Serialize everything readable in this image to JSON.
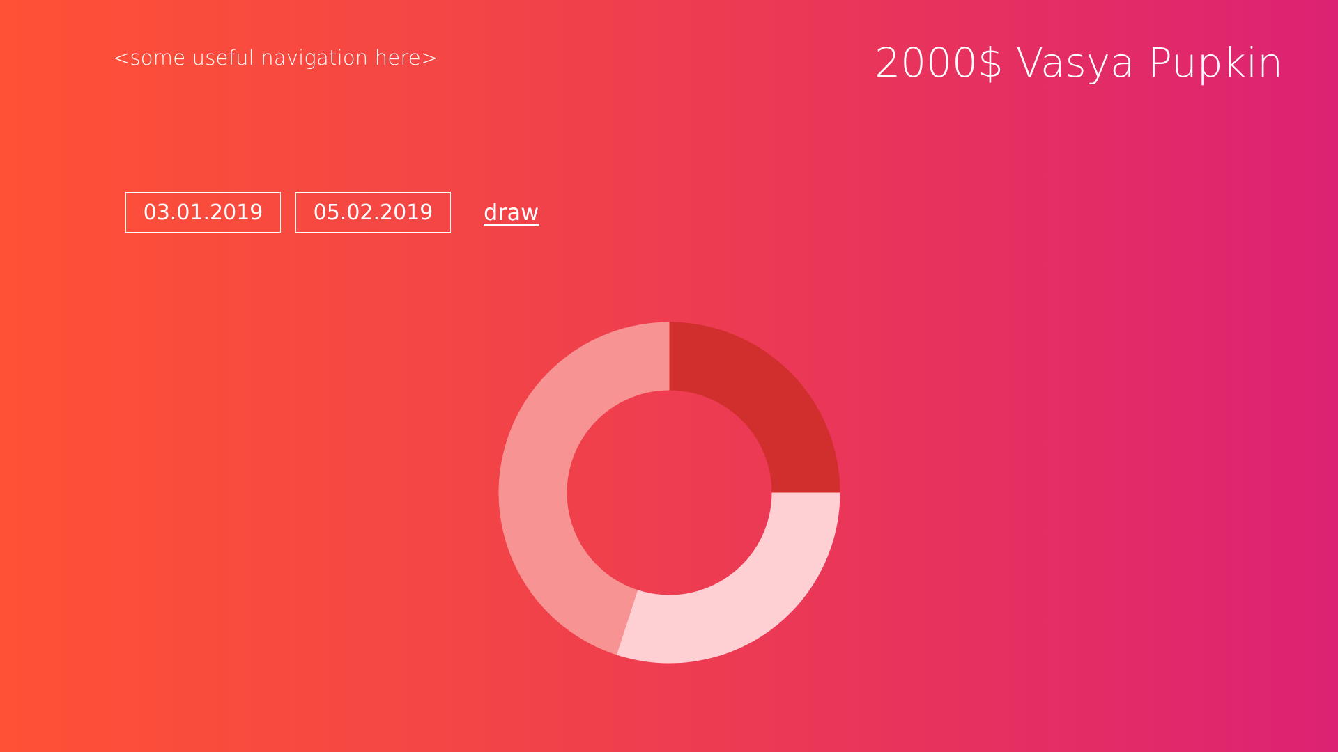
{
  "header": {
    "navigation_text": "<some useful navigation here>",
    "balance": "2000$",
    "user_name": "Vasya Pupkin"
  },
  "filters": {
    "start_date": "03.01.2019",
    "end_date": "05.02.2019",
    "draw_label": "draw"
  },
  "chart_data": {
    "type": "pie",
    "style": "donut",
    "slices": [
      {
        "value": 25,
        "color": "#d12e2e"
      },
      {
        "value": 30,
        "color": "#ffd0d3"
      },
      {
        "value": 45,
        "color": "#f89393"
      }
    ]
  },
  "colors": {
    "background_start": "#ff5135",
    "background_end": "#dc2273",
    "text": "#ffffff"
  }
}
